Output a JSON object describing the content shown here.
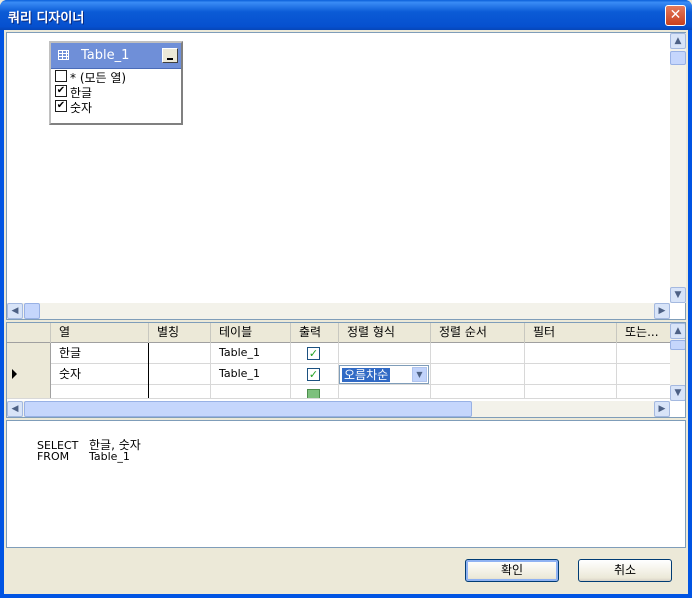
{
  "window": {
    "title": "쿼리 디자이너",
    "close_glyph": "✕"
  },
  "diagram": {
    "table_name": "Table_1",
    "columns": [
      {
        "label": "* (모든 열)",
        "checked": false
      },
      {
        "label": "한글",
        "checked": true
      },
      {
        "label": "숫자",
        "checked": true
      }
    ]
  },
  "grid": {
    "headers": [
      "열",
      "별칭",
      "테이블",
      "출력",
      "정렬 형식",
      "정렬 순서",
      "필터",
      "또는..."
    ],
    "rows": [
      {
        "column": "한글",
        "alias": "",
        "table": "Table_1",
        "output": true,
        "sort_type": "",
        "sort_order": "",
        "filter": ""
      },
      {
        "column": "숫자",
        "alias": "",
        "table": "Table_1",
        "output": true,
        "sort_type": "오름차순",
        "sort_order": "",
        "filter": ""
      }
    ]
  },
  "sql": {
    "line1_keyword": "SELECT",
    "line1_text": "한글, 숫자",
    "line2_keyword": "FROM",
    "line2_text": "Table_1"
  },
  "buttons": {
    "ok": "확인",
    "cancel": "취소"
  },
  "icons": {
    "check": "✔",
    "grid_check": "✓",
    "arrow_left": "◀",
    "arrow_right": "▶",
    "arrow_up": "▲",
    "arrow_down": "▼"
  },
  "colors": {
    "titlebar": "#0054e3",
    "selection": "#316ac5",
    "table_header": "#6f8fd8"
  }
}
